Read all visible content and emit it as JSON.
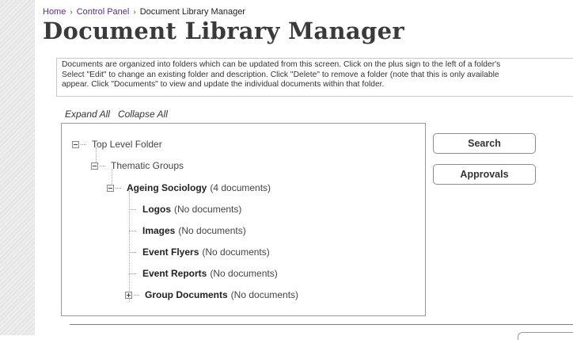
{
  "breadcrumb": {
    "items": [
      "Home",
      "Control Panel",
      "Document Library Manager"
    ]
  },
  "page_title": "Document Library Manager",
  "instructions": {
    "lines": [
      "Documents are organized into folders which can be updated from this screen. Click on the plus sign to the left of a folder's",
      "Select \"Edit\" to change an existing folder and description. Click \"Delete\" to remove a folder (note that this is only available",
      "appear. Click \"Documents\" to view and update the individual documents within that folder."
    ]
  },
  "tree_controls": {
    "expand_all": "Expand All",
    "collapse_all": "Collapse All"
  },
  "tree": {
    "top": {
      "label": "Top Level Folder"
    },
    "thematic": {
      "label": "Thematic Groups"
    },
    "ageing": {
      "name": "Ageing Sociology",
      "count": "(4 documents)"
    },
    "logos": {
      "name": "Logos",
      "count": "(No documents)"
    },
    "images": {
      "name": "Images",
      "count": "(No documents)"
    },
    "flyers": {
      "name": "Event Flyers",
      "count": "(No documents)"
    },
    "reports": {
      "name": "Event Reports",
      "count": "(No documents)"
    },
    "group_docs": {
      "name": "Group Documents",
      "count": "(No documents)"
    }
  },
  "buttons": {
    "search": "Search",
    "approvals": "Approvals"
  },
  "colors": {
    "link": "#5b2d82",
    "title": "#3a3a3a"
  }
}
